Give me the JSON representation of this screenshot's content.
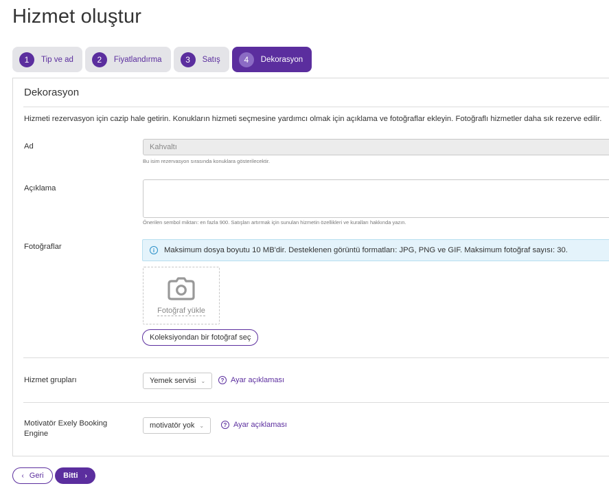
{
  "page": {
    "title": "Hizmet oluştur"
  },
  "steps": [
    {
      "num": "1",
      "label": "Tip ve ad"
    },
    {
      "num": "2",
      "label": "Fiyatlandırma"
    },
    {
      "num": "3",
      "label": "Satış"
    },
    {
      "num": "4",
      "label": "Dekorasyon"
    }
  ],
  "section": {
    "title": "Dekorasyon",
    "intro": "Hizmeti rezervasyon için cazip hale getirin. Konukların hizmeti seçmesine yardımcı olmak için açıklama ve fotoğraflar ekleyin. Fotoğraflı hizmetler daha sık rezerve edilir."
  },
  "fields": {
    "name": {
      "label": "Ad",
      "value": "Kahvaltı",
      "hint": "Bu isim rezervasyon sırasında konuklara gösterilecektir."
    },
    "description": {
      "label": "Açıklama",
      "value": "",
      "hint": "Önerilen sembol miktarı: en fazla 900. Satışları artırmak için sunulan hizmetin özellikleri ve kuralları hakkında yazın."
    },
    "photos": {
      "label": "Fotoğraflar",
      "info": "Maksimum dosya boyutu 10 MB'dir. Desteklenen görüntü formatları: JPG, PNG ve GIF. Maksimum fotoğraf sayısı: 30.",
      "upload_label": "Fotoğraf yükle",
      "collection_button": "Koleksiyondan bir fotoğraf seç"
    },
    "groups": {
      "label": "Hizmet grupları",
      "selected": "Yemek servisi",
      "help": "Ayar açıklaması"
    },
    "motivator": {
      "label": "Motivatör Exely Booking Engine",
      "selected": "motivatör yok",
      "help": "Ayar açıklaması"
    }
  },
  "footer": {
    "back_label": "Geri",
    "done_label": "Bitti"
  },
  "icons": {
    "camera": "camera-icon",
    "info": "info-icon",
    "help": "question-circle-icon",
    "chevron": "chevron-down-icon"
  },
  "colors": {
    "accent": "#5b2e9e",
    "info_bg": "#e4f3fb",
    "step_bg": "#e4e4e8"
  }
}
